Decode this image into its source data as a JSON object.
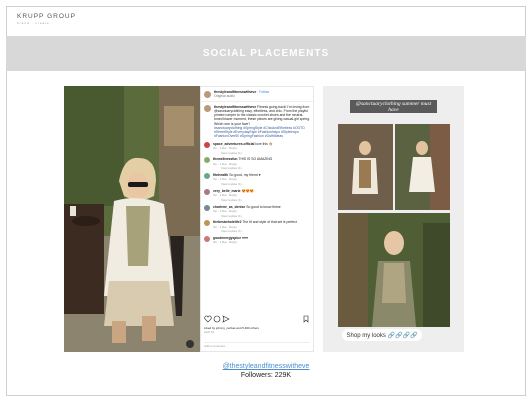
{
  "logo": {
    "name": "KRUPP GROUP",
    "tagline": "brand · create"
  },
  "banner": {
    "title": "SOCIAL PLACEMENTS"
  },
  "instagram_post": {
    "username": "thestyleandfitnesswitheve",
    "follow_label": "· Follow",
    "location": "Original audio",
    "caption_user": "thestyleandfitnesswitheve",
    "caption": "Fitness going back! I'm loving from @sanctuaryclothing easy, effortless, and chic. From the playful printed romper to the classic crochet shoes and the neutral-toned blazer moment, these pieces are giving casual-girl spring. Which one is your fave?",
    "hashtags": "#sanctuaryclothing #SpringStyle #ChicAndEffortless #OOTD #StreetStyle #EverydayStyle #FashionInspo #StyleInspo #FashionOver50 #SpringFashion #OutfitIdeas",
    "comments": [
      {
        "user": "space_adventures.official",
        "text": "love this 👏🏼",
        "meta": "3w · 1 like · Reply",
        "replies": "View replies (1)"
      },
      {
        "user": "thewellnessfun",
        "text": "THIS IS SO AMAZING",
        "meta": "3w · 1 like · Reply",
        "replies": "View replies (1)"
      },
      {
        "user": "fitnhealth",
        "text": "So good, my friend ♥",
        "meta": "3w · 1 like · Reply",
        "replies": "View replies (1)"
      },
      {
        "user": "very_belle_marie",
        "text": "😍😍😍",
        "meta": "3w · 1 like · Reply",
        "replies": "View replies (1)"
      },
      {
        "user": "charlene_as_denise",
        "text": "So good to know these",
        "meta": "3w · 1 like · Reply",
        "replies": "View replies (1)"
      },
      {
        "user": "thebestwholelife2",
        "text": "The fit and style of that set is perfect",
        "meta": "3w · 1 like · Reply",
        "replies": "View replies (1)"
      },
      {
        "user": "goodenergyspice",
        "text": "♥♥♥",
        "meta": "3w · 1 like · Reply",
        "replies": ""
      }
    ],
    "likes": "Liked by johnny_cerbas and 5,460 others",
    "date": "April 15",
    "add_comment_placeholder": "Add a comment…"
  },
  "story": {
    "heading": "@sanctuaryclothing summer must have",
    "shop_label": "Shop my looks 🔗🔗🔗🔗"
  },
  "account": {
    "handle": "@thestyleandfitnesswitheve",
    "followers": "Followers: 229K"
  }
}
